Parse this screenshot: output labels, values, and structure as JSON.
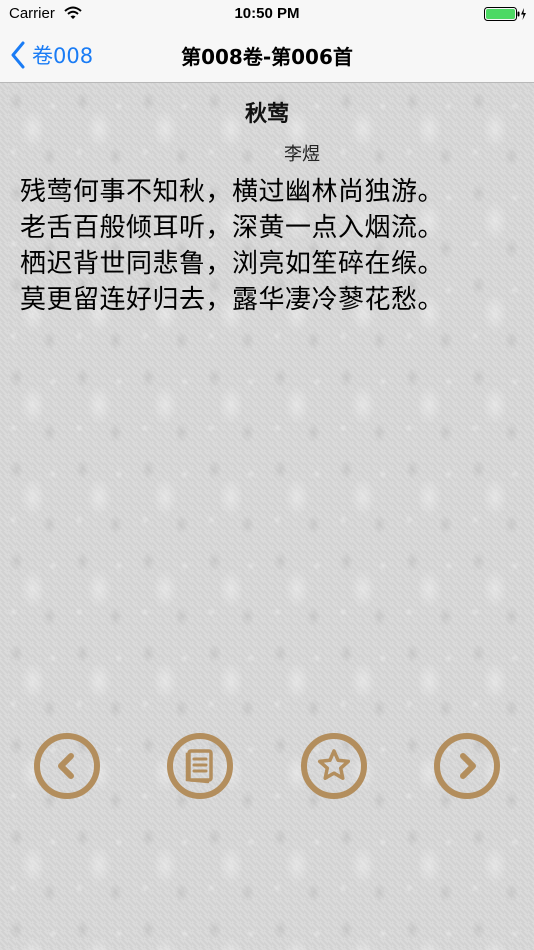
{
  "status_bar": {
    "carrier": "Carrier",
    "time": "10:50 PM"
  },
  "nav": {
    "back_label": "卷008",
    "title": "第008卷-第006首"
  },
  "poem": {
    "title": "秋莺",
    "author": "李煜",
    "lines": [
      "残莺何事不知秋，横过幽林尚独游。",
      "老舌百般倾耳听，深黄一点入烟流。",
      "栖迟背世同悲鲁，浏亮如笙碎在缑。",
      "莫更留连好归去，露华凄冷蓼花愁。"
    ]
  },
  "controls": {
    "accent_color": "#b38e5d",
    "items": [
      "previous-icon",
      "catalog-icon",
      "favorite-star-icon",
      "next-icon"
    ]
  }
}
